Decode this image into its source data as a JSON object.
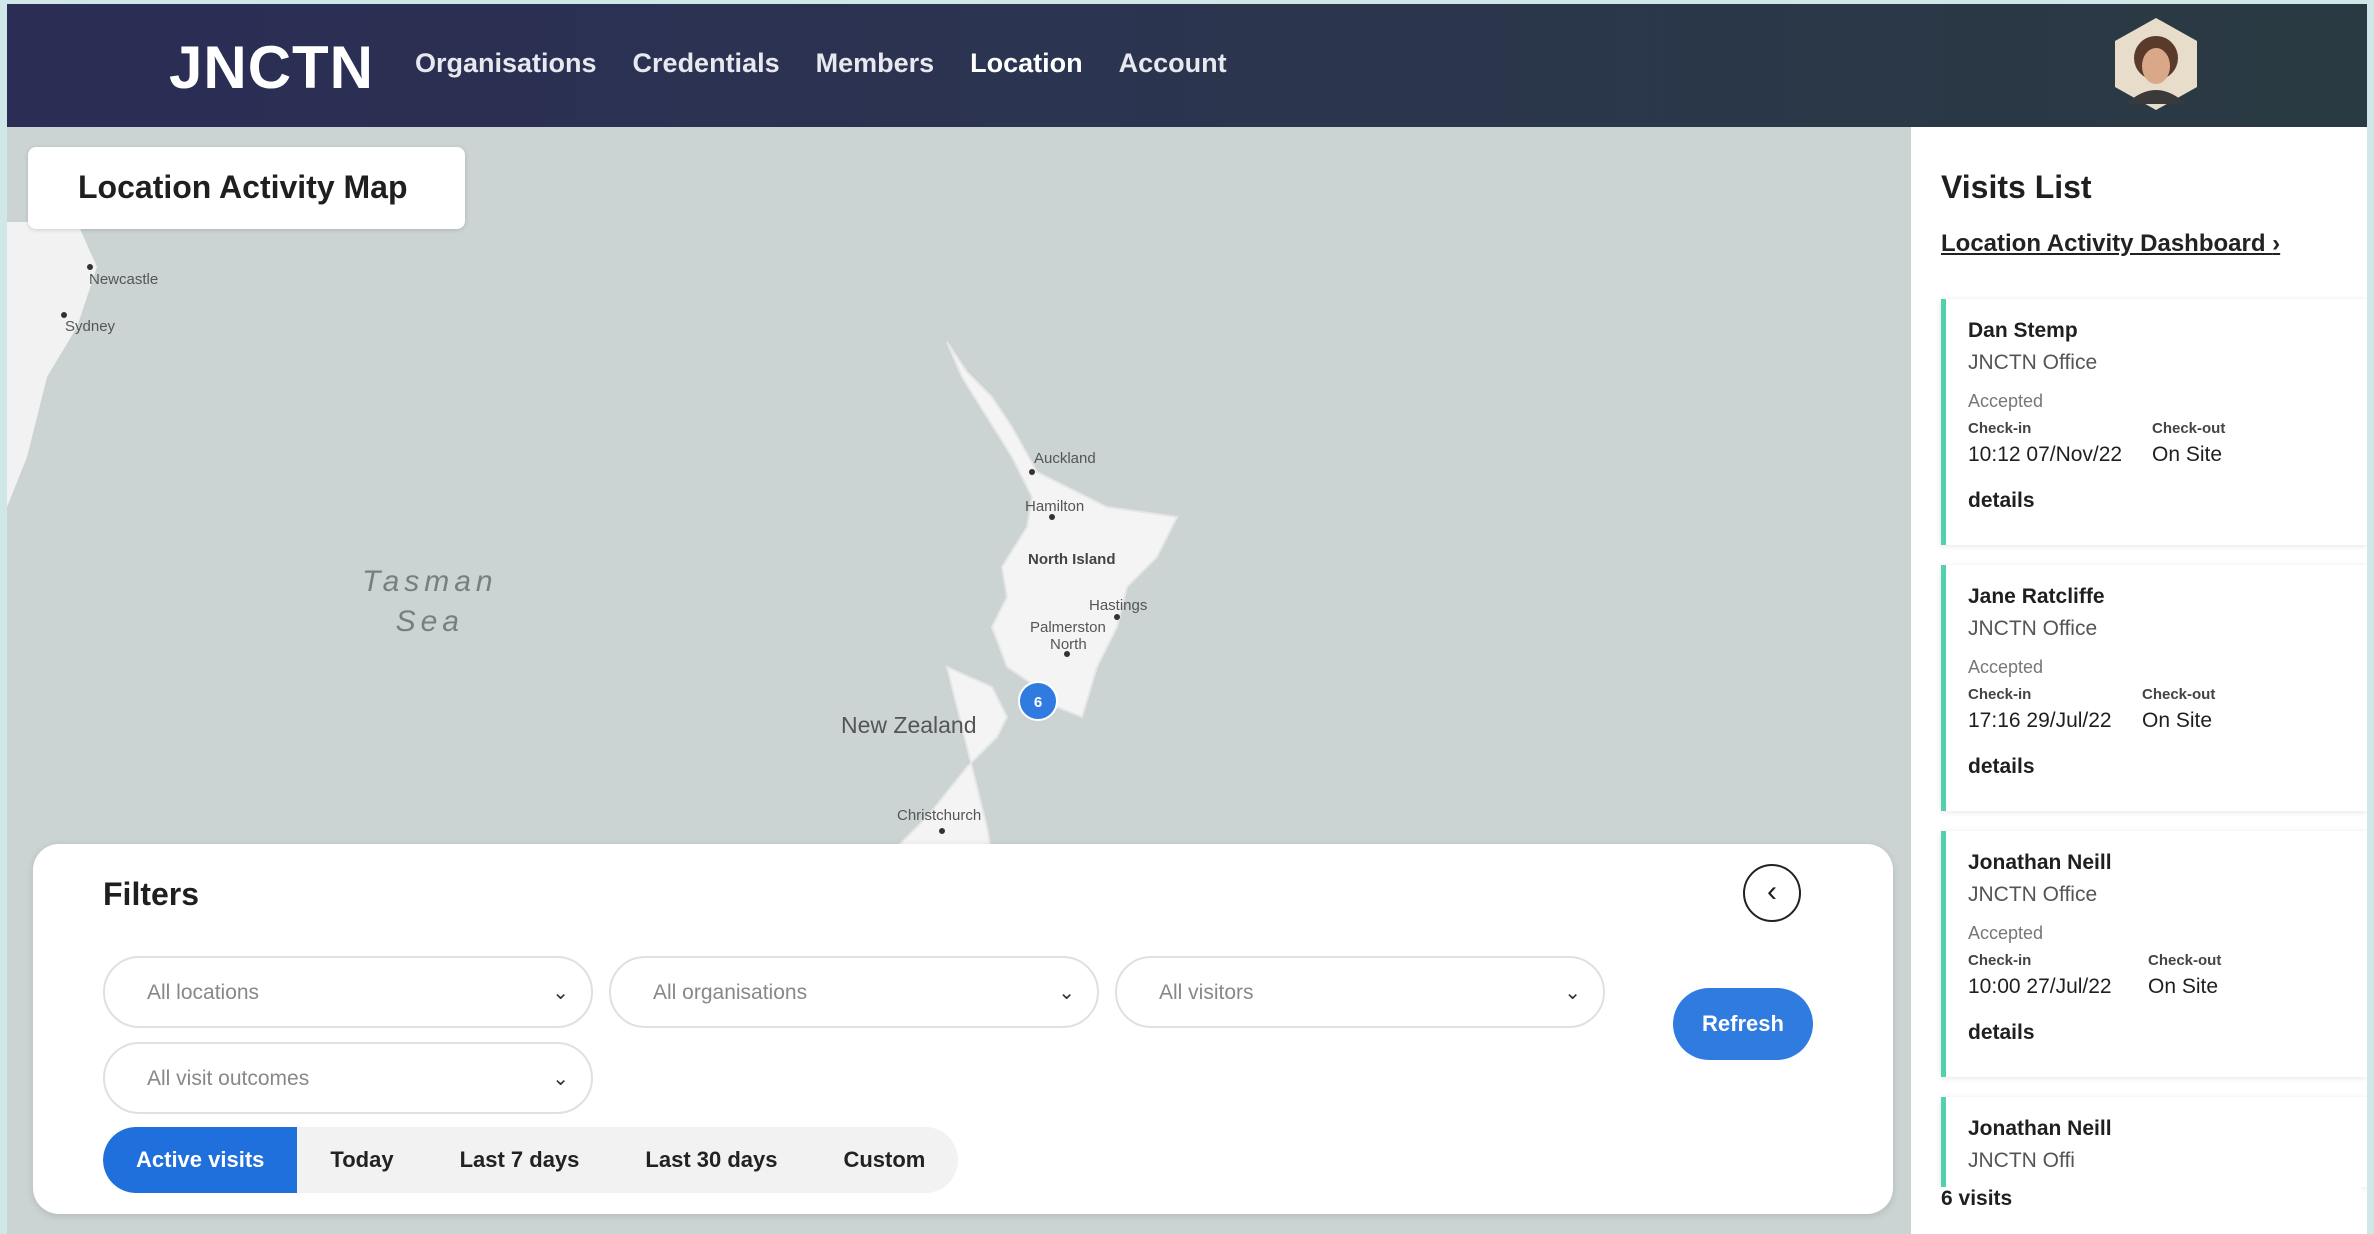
{
  "header": {
    "logo": "JNCTN",
    "nav": [
      "Organisations",
      "Credentials",
      "Members",
      "Location",
      "Account"
    ],
    "active_nav": "Location"
  },
  "map": {
    "title": "Location Activity Map",
    "labels": {
      "newcastle": "Newcastle",
      "sydney": "Sydney",
      "auckland": "Auckland",
      "hamilton": "Hamilton",
      "north_island": "North Island",
      "hastings": "Hastings",
      "palmerston": "Palmerston",
      "north": "North",
      "new_zealand": "New Zealand",
      "christchurch": "Christchurch",
      "tasman": "Tasman",
      "sea": "Sea"
    },
    "cluster_count": "6"
  },
  "filters": {
    "title": "Filters",
    "locations": "All locations",
    "organisations": "All organisations",
    "visitors": "All visitors",
    "outcomes": "All visit outcomes",
    "refresh": "Refresh",
    "ranges": [
      "Active visits",
      "Today",
      "Last 7 days",
      "Last 30 days",
      "Custom"
    ],
    "active_range": "Active visits"
  },
  "sidebar": {
    "title": "Visits List",
    "dashboard_link": "Location Activity Dashboard",
    "checkin_label": "Check-in",
    "checkout_label": "Check-out",
    "details_label": "details",
    "visits": [
      {
        "name": "Dan Stemp",
        "org": "JNCTN Office",
        "status": "Accepted",
        "checkin": "10:12 07/Nov/22",
        "checkout": "On Site"
      },
      {
        "name": "Jane Ratcliffe",
        "org": "JNCTN Office",
        "status": "Accepted",
        "checkin": "17:16 29/Jul/22",
        "checkout": "On Site"
      },
      {
        "name": "Jonathan Neill",
        "org": "JNCTN Office",
        "status": "Accepted",
        "checkin": "10:00 27/Jul/22",
        "checkout": "On Site"
      },
      {
        "name": "Jonathan Neill",
        "org": "JNCTN Offi",
        "status": "",
        "checkin": "",
        "checkout": ""
      }
    ],
    "count": "6 visits"
  },
  "colors": {
    "accent": "#2f7be0",
    "card_border": "#52d0b0",
    "header": "#2b2d55"
  }
}
